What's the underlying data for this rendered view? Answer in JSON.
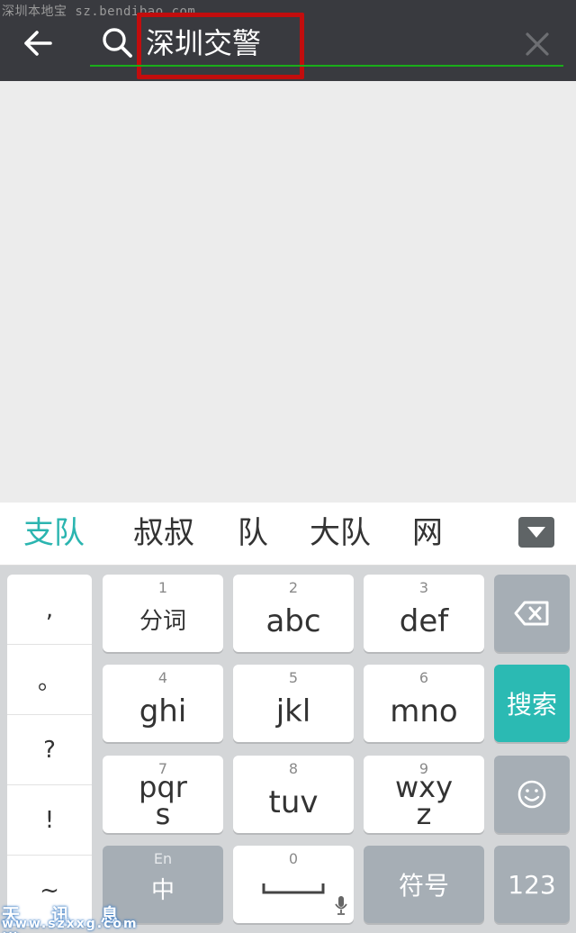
{
  "watermark_top": "深圳本地宝 sz.bendibao.com",
  "search": {
    "query": "深圳交警"
  },
  "candidates": [
    "支队",
    "叔叔",
    "队",
    "大队",
    "网"
  ],
  "keyboard": {
    "symbols": [
      ",",
      "。",
      "?",
      "!",
      "~"
    ],
    "keys": [
      {
        "num": "1",
        "label": "分词"
      },
      {
        "num": "2",
        "label": "abc"
      },
      {
        "num": "3",
        "label": "def"
      },
      {
        "num": "4",
        "label": "ghi"
      },
      {
        "num": "5",
        "label": "jkl"
      },
      {
        "num": "6",
        "label": "mno"
      },
      {
        "num": "7",
        "label": "pqr",
        "label2": "s"
      },
      {
        "num": "8",
        "label": "tuv"
      },
      {
        "num": "9",
        "label": "wxy",
        "label2": "z"
      }
    ],
    "search_key": "搜索",
    "lang_top": "En",
    "lang_main": "中",
    "space_num": "0",
    "symbols_key": "符号",
    "numbers_key": "123",
    "accent_color": "#2bbab3"
  },
  "watermark_bottom": {
    "line1": "天 讯 息 港",
    "line2": "www.szxxg.com"
  }
}
